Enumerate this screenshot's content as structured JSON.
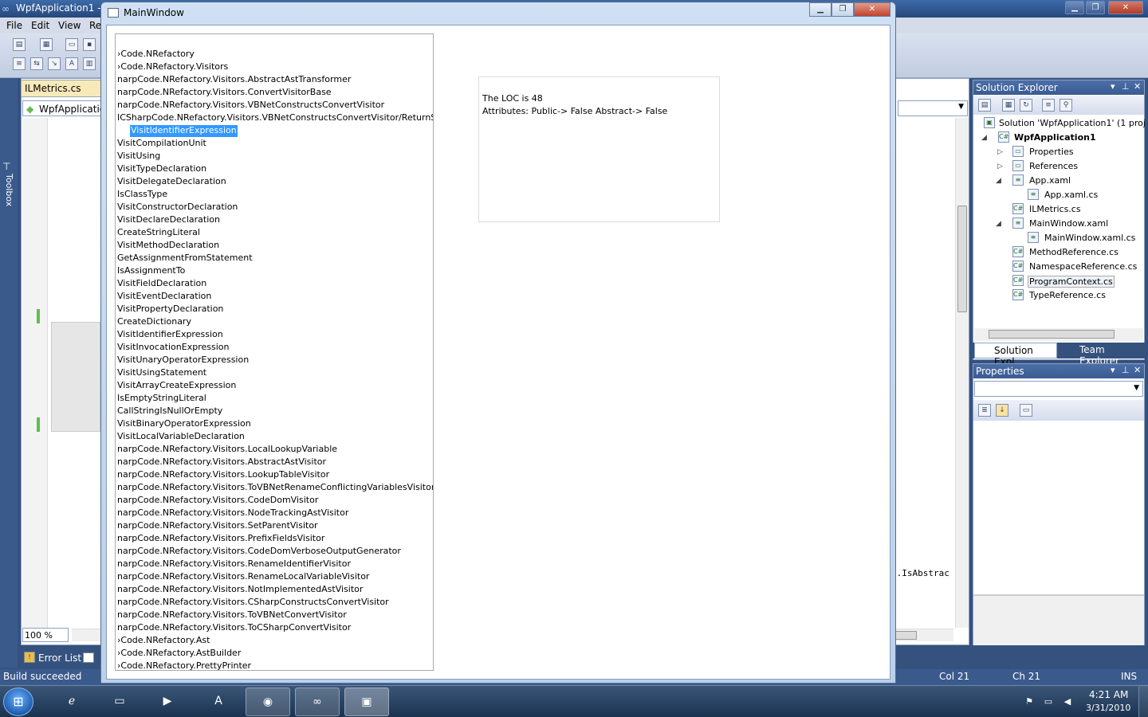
{
  "vs": {
    "title": "WpfApplication1 -",
    "menu": [
      "File",
      "Edit",
      "View",
      "Re"
    ],
    "editor_tab": "ILMetrics.cs",
    "editor_nav": "WpfApplicatio",
    "toolbox_label": "Toolbox",
    "zoom": "100 %",
    "code_fragment": "n.IsAbstrac",
    "solution_explorer": {
      "title": "Solution Explorer",
      "items": [
        "Solution 'WpfApplication1' (1 proj",
        "WpfApplication1",
        "Properties",
        "References",
        "App.xaml",
        "App.xaml.cs",
        "ILMetrics.cs",
        "MainWindow.xaml",
        "MainWindow.xaml.cs",
        "MethodReference.cs",
        "NamespaceReference.cs",
        "ProgramContext.cs",
        "TypeReference.cs"
      ],
      "tab_active": "Solution Expl...",
      "tab_other": "Team Explorer"
    },
    "properties_title": "Properties",
    "error_list": "Error List",
    "status": {
      "message": "Build succeeded",
      "col": "Col 21",
      "ch": "Ch 21",
      "mode": "INS"
    }
  },
  "main_window": {
    "title": "MainWindow",
    "tree_lines": [
      "›Code.NRefactory",
      "›Code.NRefactory.Visitors",
      "narpCode.NRefactory.Visitors.AbstractAstTransformer",
      "narpCode.NRefactory.Visitors.ConvertVisitorBase",
      "narpCode.NRefactory.Visitors.VBNetConstructsConvertVisitor",
      "ICSharpCode.NRefactory.Visitors.VBNetConstructsConvertVisitor/ReturnSta",
      "VisitIdentifierExpression",
      "VisitCompilationUnit",
      "VisitUsing",
      "VisitTypeDeclaration",
      "VisitDelegateDeclaration",
      "IsClassType",
      "VisitConstructorDeclaration",
      "VisitDeclareDeclaration",
      "CreateStringLiteral",
      "VisitMethodDeclaration",
      "GetAssignmentFromStatement",
      "IsAssignmentTo",
      "VisitFieldDeclaration",
      "VisitEventDeclaration",
      "VisitPropertyDeclaration",
      "CreateDictionary",
      "VisitIdentifierExpression",
      "VisitInvocationExpression",
      "VisitUnaryOperatorExpression",
      "VisitUsingStatement",
      "VisitArrayCreateExpression",
      "IsEmptyStringLiteral",
      "CallStringIsNullOrEmpty",
      "VisitBinaryOperatorExpression",
      "VisitLocalVariableDeclaration",
      "narpCode.NRefactory.Visitors.LocalLookupVariable",
      "narpCode.NRefactory.Visitors.AbstractAstVisitor",
      "narpCode.NRefactory.Visitors.LookupTableVisitor",
      "narpCode.NRefactory.Visitors.ToVBNetRenameConflictingVariablesVisitor",
      "narpCode.NRefactory.Visitors.CodeDomVisitor",
      "narpCode.NRefactory.Visitors.NodeTrackingAstVisitor",
      "narpCode.NRefactory.Visitors.SetParentVisitor",
      "narpCode.NRefactory.Visitors.PrefixFieldsVisitor",
      "narpCode.NRefactory.Visitors.CodeDomVerboseOutputGenerator",
      "narpCode.NRefactory.Visitors.RenameIdentifierVisitor",
      "narpCode.NRefactory.Visitors.RenameLocalVariableVisitor",
      "narpCode.NRefactory.Visitors.NotImplementedAstVisitor",
      "narpCode.NRefactory.Visitors.CSharpConstructsConvertVisitor",
      "narpCode.NRefactory.Visitors.ToVBNetConvertVisitor",
      "narpCode.NRefactory.Visitors.ToCSharpConvertVisitor",
      "›Code.NRefactory.Ast",
      "›Code.NRefactory.AstBuilder",
      "›Code.NRefactory.PrettyPrinter"
    ],
    "info_loc": "The LOC is 48",
    "info_attributes": "Attributes: Public-> False Abstract-> False"
  },
  "taskbar": {
    "time": "4:21 AM",
    "date": "3/31/2010"
  }
}
